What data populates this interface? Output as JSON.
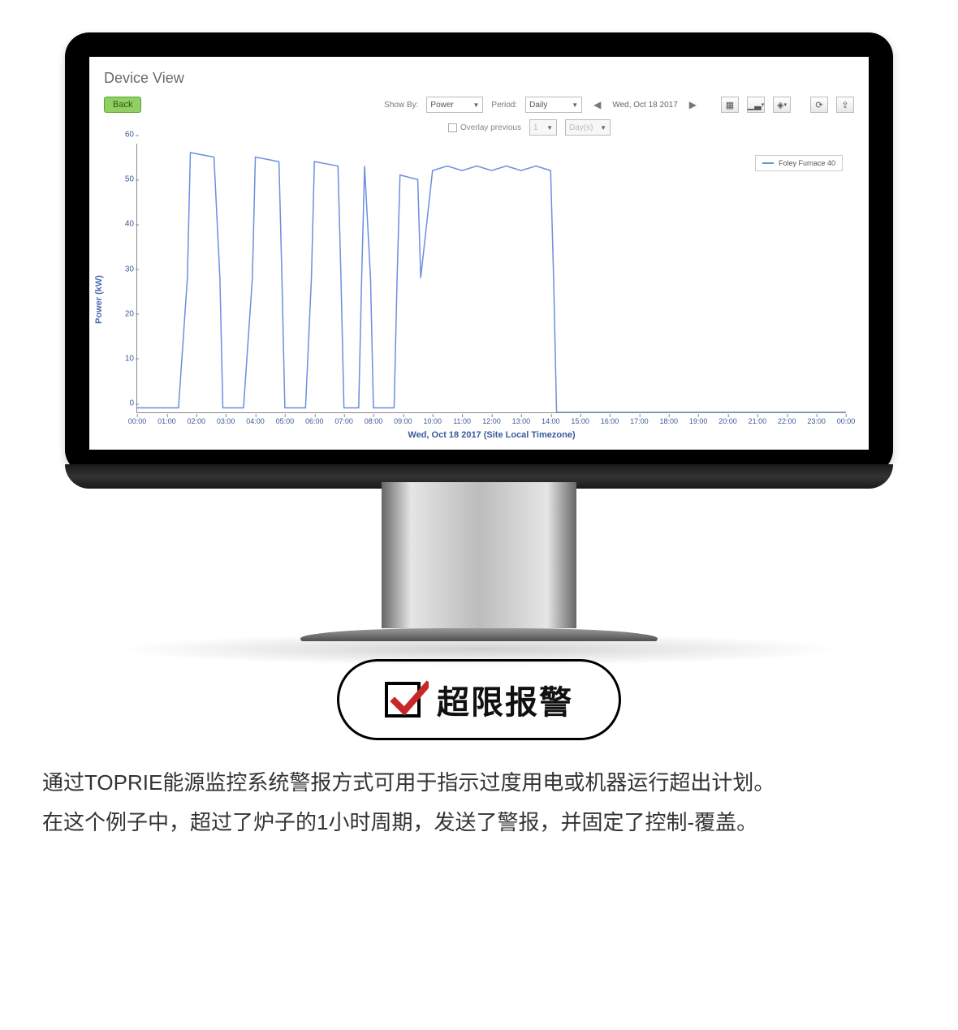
{
  "dashboard": {
    "title": "Device View",
    "back_label": "Back",
    "show_by_label": "Show By:",
    "show_by_value": "Power",
    "period_label": "Period:",
    "period_value": "Daily",
    "date_label": "Wed, Oct 18 2017",
    "overlay_label": "Overlay previous",
    "overlay_count": "1",
    "overlay_unit": "Day(s)",
    "y_axis_label": "Power (kW)",
    "x_axis_caption": "Wed, Oct 18 2017 (Site Local Timezone)",
    "legend_label": "Foley Furnace 40"
  },
  "chart_data": {
    "type": "line",
    "title": "Device View",
    "xlabel": "Wed, Oct 18 2017 (Site Local Timezone)",
    "ylabel": "Power (kW)",
    "ylim": [
      0,
      60
    ],
    "x_ticks": [
      "00:00",
      "01:00",
      "02:00",
      "03:00",
      "04:00",
      "05:00",
      "06:00",
      "07:00",
      "08:00",
      "09:00",
      "10:00",
      "11:00",
      "12:00",
      "13:00",
      "14:00",
      "15:00",
      "16:00",
      "17:00",
      "18:00",
      "19:00",
      "20:00",
      "21:00",
      "22:00",
      "23:00",
      "00:00"
    ],
    "y_ticks": [
      0,
      10,
      20,
      30,
      40,
      50,
      60
    ],
    "series": [
      {
        "name": "Foley Furnace 40",
        "color": "#6b8fe0",
        "x": [
          0,
          1.4,
          1.7,
          1.8,
          2.6,
          2.8,
          2.9,
          3.6,
          3.9,
          4.0,
          4.8,
          4.9,
          5.0,
          5.7,
          5.9,
          6.0,
          6.8,
          6.9,
          7.0,
          7.5,
          7.6,
          7.7,
          7.9,
          8.0,
          8.7,
          8.8,
          8.9,
          9.5,
          9.6,
          10.0,
          10.5,
          11.0,
          11.5,
          12.0,
          12.5,
          13.0,
          13.5,
          14.0,
          14.1,
          14.2,
          24.0
        ],
        "values": [
          1,
          1,
          30,
          58,
          57,
          30,
          1,
          1,
          30,
          57,
          56,
          30,
          1,
          1,
          30,
          56,
          55,
          30,
          1,
          1,
          30,
          55,
          30,
          1,
          1,
          30,
          53,
          52,
          30,
          54,
          55,
          54,
          55,
          54,
          55,
          54,
          55,
          54,
          30,
          0,
          0
        ]
      }
    ]
  },
  "badge": {
    "title": "超限报警"
  },
  "description": {
    "line1": "通过TOPRIE能源监控系统警报方式可用于指示过度用电或机器运行超出计划。",
    "line2": "在这个例子中，超过了炉子的1小时周期，发送了警报，并固定了控制-覆盖。"
  }
}
